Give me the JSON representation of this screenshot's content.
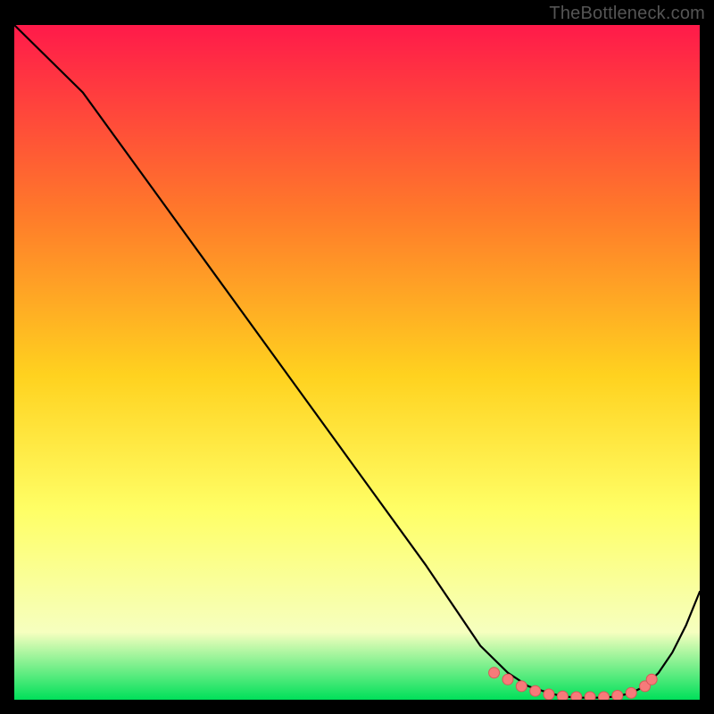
{
  "watermark": "TheBottleneck.com",
  "colors": {
    "background": "#000000",
    "gradient_top": "#ff1a4a",
    "gradient_mid_upper": "#ff7a2a",
    "gradient_mid": "#ffd21f",
    "gradient_mid_lower": "#ffff66",
    "gradient_lower": "#f6ffbf",
    "gradient_bottom": "#00e05a",
    "curve": "#000000",
    "marker_fill": "#f77a7a",
    "marker_stroke": "#d85858"
  },
  "chart_data": {
    "type": "line",
    "title": "",
    "xlabel": "",
    "ylabel": "",
    "xlim": [
      0,
      100
    ],
    "ylim": [
      0,
      100
    ],
    "grid": false,
    "legend": false,
    "series": [
      {
        "name": "bottleneck-curve",
        "x": [
          0,
          6,
          10,
          20,
          30,
          40,
          50,
          60,
          68,
          72,
          75,
          78,
          80,
          82,
          84,
          86,
          88,
          90,
          92,
          94,
          96,
          98,
          100
        ],
        "values": [
          100,
          94,
          90,
          76,
          62,
          48,
          34,
          20,
          8,
          4,
          2,
          1,
          0.5,
          0.3,
          0.3,
          0.3,
          0.5,
          1,
          2,
          4,
          7,
          11,
          16
        ]
      }
    ],
    "markers": {
      "name": "optimal-region-dots",
      "x": [
        70,
        72,
        74,
        76,
        78,
        80,
        82,
        84,
        86,
        88,
        90,
        92,
        93
      ],
      "values": [
        4,
        3,
        2,
        1.3,
        0.8,
        0.5,
        0.4,
        0.4,
        0.4,
        0.6,
        1,
        2,
        3
      ]
    }
  }
}
